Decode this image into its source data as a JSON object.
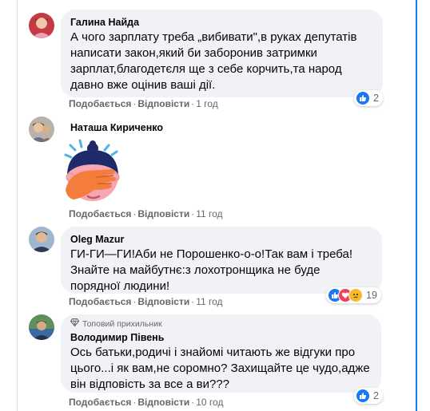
{
  "comments": [
    {
      "author": "Галина Найда",
      "lines": [
        "А чого зарплату треба „вибивати\",в руках депутатів",
        "написати закон,який би заборонив затримки",
        "зарплат,благодетєля ще з себе корчить,та народ",
        "давно вже оцінив ваші дії."
      ],
      "like_label": "Подобається",
      "reply_label": "Відповісти",
      "time": "1 год",
      "reaction_count": "2"
    },
    {
      "author": "Наташа Кириченко",
      "sticker": "facepalm-sticker",
      "like_label": "Подобається",
      "reply_label": "Відповісти",
      "time": "11 год"
    },
    {
      "author": "Oleg Mazur",
      "lines": [
        "ГИ-ГИ—ГИ!Аби не Порошенко-о-о!Так вам і треба!",
        "Знайте на майбутнє:з лохотронщика не буде",
        "порядної людини!"
      ],
      "like_label": "Подобається",
      "reply_label": "Відповісти",
      "time": "11 год",
      "reaction_count": "19"
    },
    {
      "badge": "Топовий прихильник",
      "author": "Володимир Півень",
      "lines": [
        "Ось батьки,родичі і знайомі читають же відгуки про",
        "цього...і як вам,не соромно? Захищайте це чудо,адже",
        "він відповість за все а ви???"
      ],
      "like_label": "Подобається",
      "reply_label": "Відповісти",
      "time": "10 год",
      "reaction_count": "2"
    }
  ],
  "colors": {
    "bubble": "#f0f2f5",
    "like": "#1877f2",
    "love": "#f33e58",
    "sad": "#f7b928",
    "meta": "#65676b"
  }
}
